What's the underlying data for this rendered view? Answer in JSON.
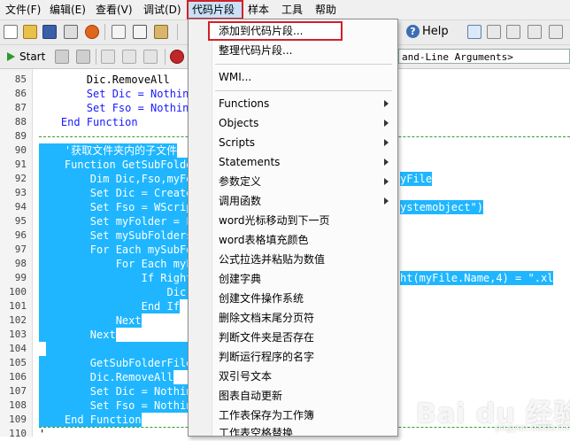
{
  "menubar": {
    "items": [
      "文件(F)",
      "编辑(E)",
      "查看(V)",
      "调试(D)",
      "代码片段",
      "样本",
      "工具",
      "帮助"
    ]
  },
  "toolbar": {
    "help_label": "Help",
    "start_label": "Start",
    "arguments_field": "and-Line Arguments>"
  },
  "editor": {
    "line_numbers": [
      "85",
      "86",
      "87",
      "88",
      "89",
      "90",
      "91",
      "92",
      "93",
      "94",
      "95",
      "96",
      "97",
      "98",
      "99",
      "100",
      "101",
      "102",
      "103",
      "104",
      "105",
      "106",
      "107",
      "108",
      "109",
      "110"
    ],
    "lines": [
      "        Dic.RemoveAll",
      "        Set Dic = Nothing",
      "        Set Fso = Nothing",
      "    End Function",
      "",
      "    '获取文件夹内的子文件",
      "    Function GetSubFolder",
      "        Dim Dic,Fso,myFol",
      "        Set Dic = CreateO",
      "        Set Fso = WScript",
      "        Set myFolder = Fs",
      "        Set mySubFolders",
      "        For Each mySubFol",
      "            For Each myFi",
      "                If Right(",
      "                    Dic(m",
      "                End If",
      "            Next",
      "        Next",
      "",
      "        GetSubFolderFiles",
      "        Dic.RemoveAll",
      "        Set Dic = Nothing",
      "        Set Fso = Nothing",
      "    End Function",
      "'"
    ],
    "right_fragments": {
      "l92": "yFile",
      "l94": "ystemobject\")",
      "l99": "ht(myFile.Name,4) = \".xl"
    }
  },
  "dropdown": {
    "top_items": [
      "添加到代码片段...",
      "整理代码片段..."
    ],
    "wmi": "WMI...",
    "submenus": [
      "Functions",
      "Objects",
      "Scripts",
      "Statements",
      "参数定义",
      "调用函数"
    ],
    "snippets": [
      "word光标移动到下一页",
      "word表格填充颜色",
      "公式拉选并粘贴为数值",
      "创建字典",
      "创建文件操作系统",
      "删除文档末尾分页符",
      "判断文件夹是否存在",
      "判断运行程序的名字",
      "双引号文本",
      "图表自动更新",
      "工作表保存为工作簿",
      "工作表空格替换"
    ]
  },
  "watermark": {
    "brand": "Bai du 经验",
    "url": "jingyan.baidu.com"
  }
}
